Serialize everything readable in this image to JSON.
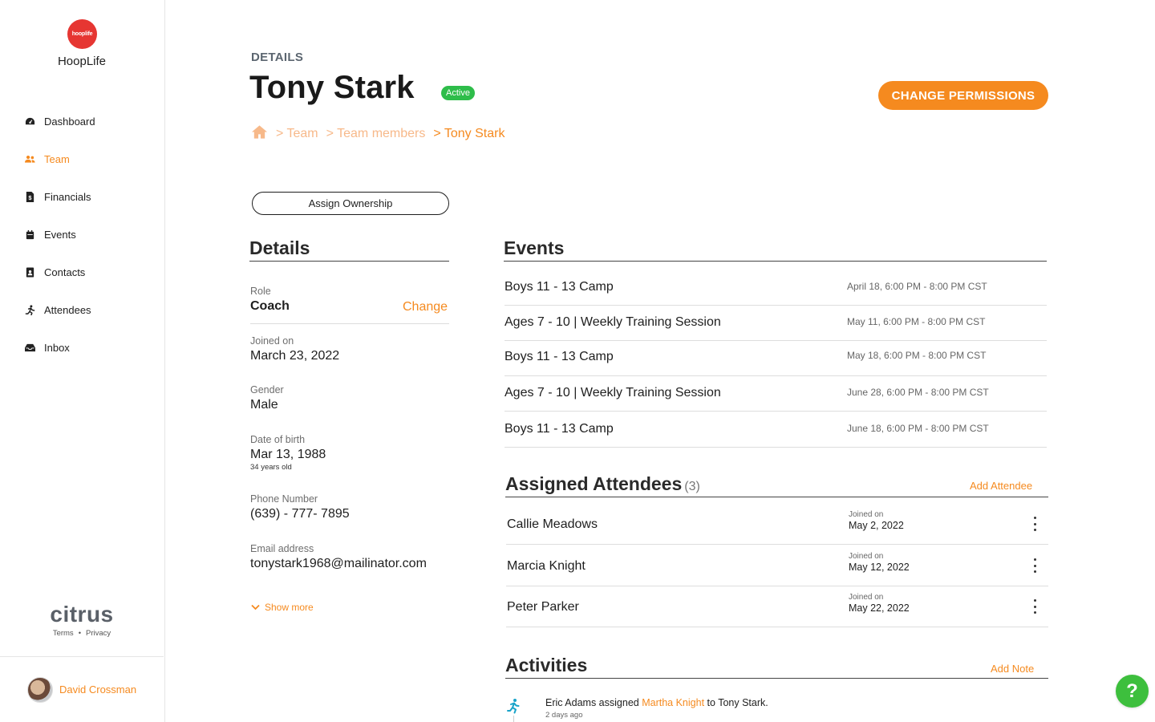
{
  "app": {
    "logo_text": "hooplife",
    "name": "HoopLife"
  },
  "sidebar": {
    "items": [
      {
        "label": "Dashboard",
        "icon": "dashboard-icon",
        "active": false
      },
      {
        "label": "Team",
        "icon": "team-icon",
        "active": true
      },
      {
        "label": "Financials",
        "icon": "financials-icon",
        "active": false
      },
      {
        "label": "Events",
        "icon": "calendar-icon",
        "active": false
      },
      {
        "label": "Contacts",
        "icon": "contact-card-icon",
        "active": false
      },
      {
        "label": "Attendees",
        "icon": "running-person-icon",
        "active": false
      },
      {
        "label": "Inbox",
        "icon": "inbox-icon",
        "active": false
      }
    ],
    "footer": {
      "brand": "citrus",
      "terms": "Terms",
      "separator": "•",
      "privacy": "Privacy"
    },
    "user": {
      "name": "David Crossman"
    }
  },
  "header": {
    "eyebrow": "DETAILS",
    "title": "Tony Stark",
    "status": "Active",
    "permissions_button": "CHANGE PERMISSIONS",
    "breadcrumb": [
      "> Team",
      "> Team members",
      "> Tony Stark"
    ]
  },
  "assign_button": "Assign Ownership",
  "details": {
    "heading": "Details",
    "role_label": "Role",
    "role_value": "Coach",
    "change_label": "Change",
    "joined_label": "Joined on",
    "joined_value": "March 23, 2022",
    "gender_label": "Gender",
    "gender_value": "Male",
    "dob_label": "Date of birth",
    "dob_value": "Mar 13, 1988",
    "age": "34 years old",
    "phone_label": "Phone Number",
    "phone_value": "(639) - 777- 7895",
    "email_label": "Email address",
    "email_value": "tonystark1968@mailinator.com",
    "show_more": "Show more"
  },
  "events": {
    "heading": "Events",
    "items": [
      {
        "name": "Boys 11 - 13 Camp",
        "date": "April 18, 6:00 PM - 8:00 PM CST"
      },
      {
        "name": "Ages 7 - 10 | Weekly Training Session",
        "date": "May 11, 6:00 PM - 8:00 PM CST"
      },
      {
        "name": "Boys 11 - 13 Camp",
        "date": "May 18, 6:00 PM - 8:00 PM CST"
      },
      {
        "name": "Ages 7 - 10 | Weekly Training Session",
        "date": "June 28, 6:00 PM - 8:00 PM CST"
      },
      {
        "name": "Boys 11 - 13 Camp",
        "date": "June 18, 6:00 PM - 8:00 PM CST"
      }
    ]
  },
  "attendees": {
    "heading": "Assigned Attendees",
    "count": "(3)",
    "add_label": "Add Attendee",
    "items": [
      {
        "name": "Callie Meadows",
        "joined_label": "Joined on",
        "joined": "May 2, 2022"
      },
      {
        "name": "Marcia Knight",
        "joined_label": "Joined on",
        "joined": "May 12, 2022"
      },
      {
        "name": "Peter Parker",
        "joined_label": "Joined on",
        "joined": "May 22, 2022"
      }
    ]
  },
  "activities": {
    "heading": "Activities",
    "add_label": "Add Note",
    "items": [
      {
        "actor": "Eric Adams assigned",
        "link": "Martha Knight",
        "rest": "to Tony Stark.",
        "time": "2 days ago"
      }
    ]
  },
  "help": {
    "label": "?"
  },
  "colors": {
    "accent": "#f58a1f",
    "active_badge": "#2ebd4a",
    "logo": "#e63632",
    "help": "#3dbf3d"
  }
}
